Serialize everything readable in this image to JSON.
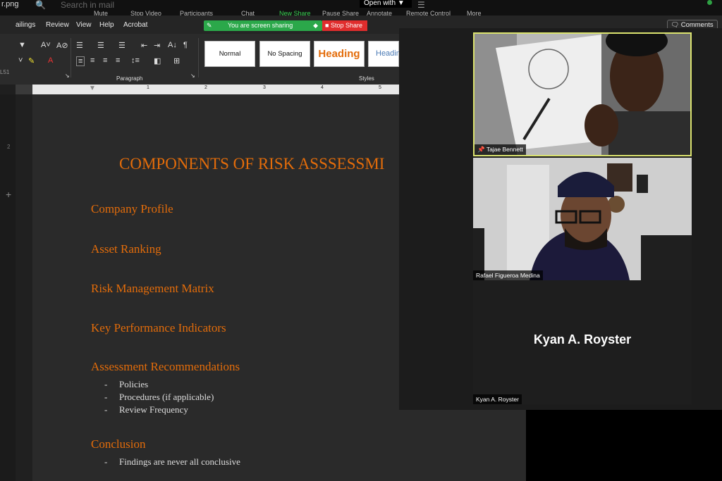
{
  "zoom_toolbar": {
    "filename": "r.png",
    "search_placeholder": "Search in mail",
    "controls": [
      "Mute",
      "Stop Video",
      "Participants",
      "Chat",
      "New Share",
      "Pause Share",
      "Annotate",
      "Remote Control",
      "More"
    ],
    "open_with": "Open with"
  },
  "ribbon": {
    "tabs": [
      "ailings",
      "Review",
      "View",
      "Help",
      "Acrobat"
    ],
    "sharing_label": "You are screen sharing",
    "stop_share": "Stop Share",
    "comments": "Comments",
    "paragraph_group": "Paragraph",
    "styles_group": "Styles",
    "styles": [
      "Normal",
      "No Spacing",
      "Heading",
      "Headin"
    ]
  },
  "left_strip": {
    "num1": "L51",
    "num2": "2",
    "plus": "+"
  },
  "ruler_labels": [
    "1",
    "2",
    "3",
    "4",
    "5"
  ],
  "document": {
    "title": "COMPONENTS OF RISK ASSSESSMI",
    "sections": [
      {
        "heading": "Company Profile",
        "items": []
      },
      {
        "heading": "Asset Ranking",
        "items": []
      },
      {
        "heading": "Risk Management Matrix",
        "items": []
      },
      {
        "heading": "Key Performance Indicators",
        "items": []
      },
      {
        "heading": "Assessment Recommendations",
        "items": [
          "Policies",
          "Procedures (if applicable)",
          "Review Frequency"
        ]
      },
      {
        "heading": "Conclusion",
        "items": [
          "Findings are never all conclusive"
        ]
      }
    ]
  },
  "participants": [
    {
      "name": "Tajae Bennett",
      "active_speaker": true
    },
    {
      "name": "Rafael Figueroa Medina",
      "active_speaker": false
    },
    {
      "name": "Kyan A. Royster",
      "video_off": true
    }
  ],
  "colors": {
    "heading_orange": "#e36c0a",
    "share_green": "#2ba84a",
    "stop_red": "#e02d2d",
    "active_border": "#dbe36f"
  }
}
